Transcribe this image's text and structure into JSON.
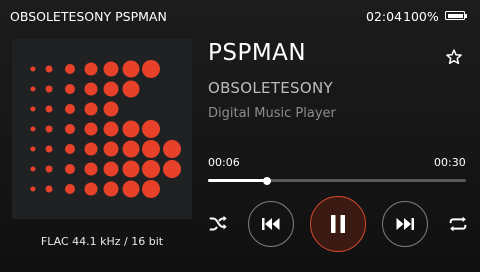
{
  "status": {
    "title": "OBSOLETESONY PSPMAN",
    "time": "02:04",
    "battery": "100%",
    "battery_level": 1.0
  },
  "track": {
    "title": "PSPMAN",
    "artist": "OBSOLETESONY",
    "album": "Digital Music Player",
    "format": "FLAC 44.1 kHz / 16 bit",
    "favorite": false
  },
  "playback": {
    "elapsed": "00:06",
    "total": "00:30",
    "progress": 0.23,
    "state": "playing"
  },
  "controls": {
    "shuffle_icon": "shuffle-icon",
    "prev_icon": "skip-previous-icon",
    "play_pause_icon": "pause-icon",
    "next_icon": "skip-next-icon",
    "repeat_icon": "repeat-icon",
    "favorite_icon": "star-outline-icon"
  },
  "theme": {
    "accent": "#e8412a",
    "background": "#161616",
    "art_background": "#1f2123"
  }
}
